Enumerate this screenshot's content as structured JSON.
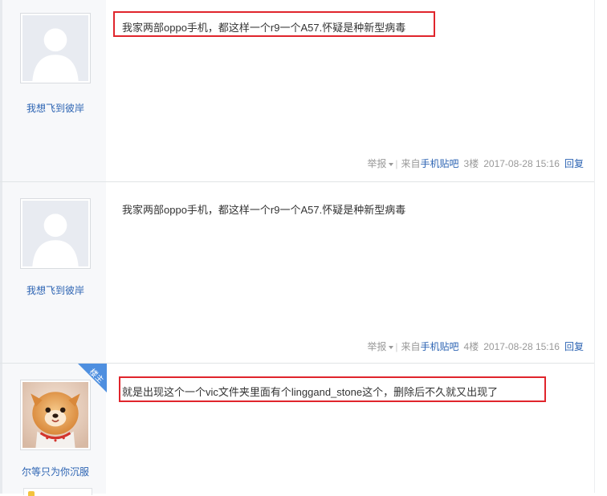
{
  "posts": [
    {
      "username": "我想飞到彼岸",
      "avatar": "default-avatar-icon",
      "content": "我家两部oppo手机，都这样一个r9一个A57.怀疑是种新型病毒",
      "highlighted": true,
      "meta": {
        "report": "举报",
        "source_prefix": "来自",
        "source_link": "手机贴吧",
        "floor": "3楼",
        "date": "2017-08-28 15:16",
        "reply": "回复"
      }
    },
    {
      "username": "我想飞到彼岸",
      "avatar": "default-avatar-icon",
      "content": "我家两部oppo手机，都这样一个r9一个A57.怀疑是种新型病毒",
      "highlighted": false,
      "meta": {
        "report": "举报",
        "source_prefix": "来自",
        "source_link": "手机贴吧",
        "floor": "4楼",
        "date": "2017-08-28 15:16",
        "reply": "回复"
      }
    },
    {
      "username": "尔等只为你沉服",
      "avatar": "dog-photo-avatar",
      "badge": "楼主",
      "content": "就是出现这个一个vic文件夹里面有个linggand_stone这个，删除后不久就又出现了",
      "highlighted": true
    }
  ],
  "colors": {
    "highlight": "#e0252c",
    "link": "#2d64b3",
    "badge": "#4e8fe0"
  }
}
